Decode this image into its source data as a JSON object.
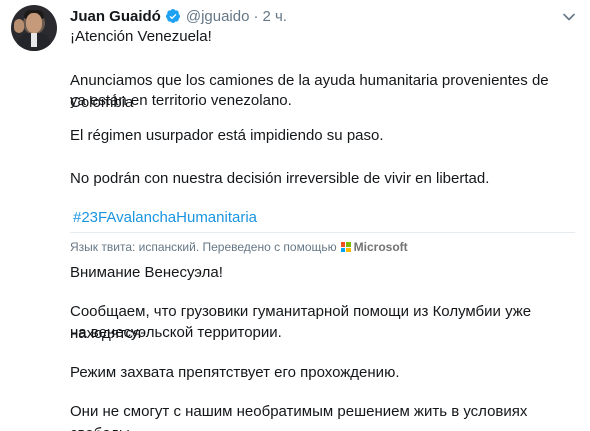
{
  "author": {
    "name": "Juan Guaidó",
    "handle": "@jguaido",
    "separator": "·",
    "time": "2 ч."
  },
  "original_tweet": {
    "line1": "¡Atención Venezuela!",
    "line2a": "Anunciamos que los camiones de la ayuda humanitaria provenientes de Colombia",
    "line2b": "ya están en territorio venezolano.",
    "line3": "El régimen usurpador está impidiendo su paso.",
    "line4": "No podrán con nuestra decisión irreversible de vivir en libertad.",
    "hashtag": "#23FAvalanchaHumanitaria"
  },
  "translation_note": {
    "label": "Язык твита: испанский. Переведено с помощью",
    "brand": "Microsoft"
  },
  "translated_tweet": {
    "line1": "Внимание Венесуэла!",
    "line2a": "Сообщаем, что грузовики гуманитарной помощи из Колумбии уже находятся",
    "line2b": "на венесуэльской территории.",
    "line3": "Режим захвата препятствует его прохождению.",
    "line4": "Они не смогут с нашим необратимым решением жить в условиях свободы."
  },
  "colors": {
    "verified": "#1da1f2",
    "hashtag": "#1b95e0",
    "secondary_text": "#657786",
    "ms_red": "#f25022",
    "ms_green": "#7fba00",
    "ms_blue": "#00a4ef",
    "ms_yellow": "#ffb900"
  },
  "icons": {
    "verified": "verified-badge-icon",
    "caret": "chevron-down-icon",
    "microsoft": "microsoft-logo-icon"
  }
}
